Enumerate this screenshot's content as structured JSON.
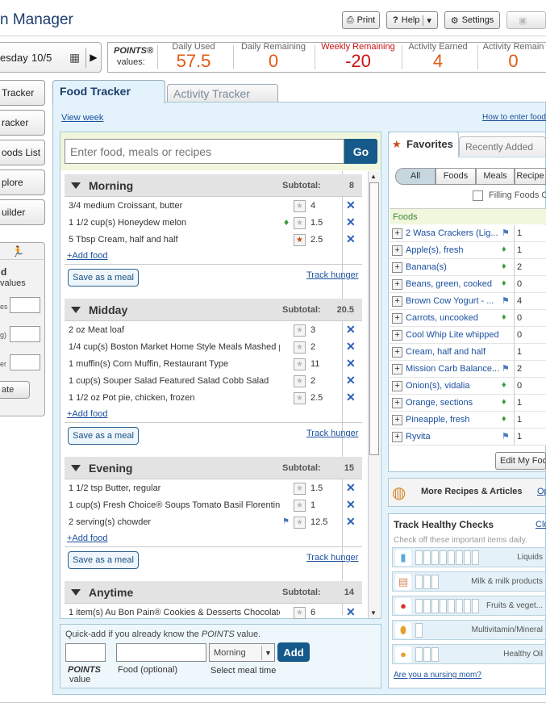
{
  "header": {
    "title": "n Manager",
    "print_label": "Print",
    "help_label": "Help",
    "settings_label": "Settings"
  },
  "datebar": {
    "date_prefix": "esday",
    "date_value": "10/5"
  },
  "points": {
    "label": "POINTS®",
    "label2": "values:",
    "cells": [
      {
        "label": "Daily Used",
        "value": "57.5",
        "color": "#e05a12"
      },
      {
        "label": "Daily Remaining",
        "value": "0",
        "color": "#e05a12"
      },
      {
        "label": "Weekly Remaining",
        "value": "-20",
        "color": "#cc1111"
      },
      {
        "label": "Activity Earned",
        "value": "4",
        "color": "#e05a12"
      },
      {
        "label": "Activity Remain",
        "value": "0",
        "color": "#e05a12"
      }
    ]
  },
  "sidebar": {
    "items": [
      "Tracker",
      "racker",
      "oods List",
      "plore",
      "uilder"
    ],
    "panel_line1": "d",
    "panel_line2": "values",
    "panel_labels": [
      "es",
      "g)",
      "er"
    ],
    "panel_button": "ate"
  },
  "tabs": {
    "food": "Food Tracker",
    "activity": "Activity Tracker"
  },
  "links": {
    "view_week": "View week",
    "how_to": "How to enter food"
  },
  "search": {
    "placeholder": "Enter food, meals or recipes",
    "go": "Go"
  },
  "meals": [
    {
      "name": "Morning",
      "subtotal_label": "Subtotal:",
      "subtotal": "8",
      "items": [
        {
          "name": "3/4 medium Croissant, butter",
          "points": "4",
          "star": false,
          "marker": ""
        },
        {
          "name": "1 1/2 cup(s) Honeydew melon",
          "points": "1.5",
          "star": false,
          "marker": "gem"
        },
        {
          "name": "5 Tbsp Cream, half and half",
          "points": "2.5",
          "star": true,
          "marker": ""
        }
      ]
    },
    {
      "name": "Midday",
      "subtotal_label": "Subtotal:",
      "subtotal": "20.5",
      "items": [
        {
          "name": "2 oz Meat loaf",
          "points": "3",
          "star": false,
          "marker": ""
        },
        {
          "name": "1/4 cup(s) Boston Market Home Style Meals Mashed p",
          "points": "2",
          "star": false,
          "marker": ""
        },
        {
          "name": "1 muffin(s) Corn Muffin, Restaurant Type",
          "points": "11",
          "star": false,
          "marker": ""
        },
        {
          "name": "1 cup(s) Souper Salad Featured Salad Cobb Salad",
          "points": "2",
          "star": false,
          "marker": ""
        },
        {
          "name": "1 1/2 oz Pot pie, chicken, frozen",
          "points": "2.5",
          "star": false,
          "marker": ""
        }
      ]
    },
    {
      "name": "Evening",
      "subtotal_label": "Subtotal:",
      "subtotal": "15",
      "items": [
        {
          "name": "1 1/2 tsp Butter, regular",
          "points": "1.5",
          "star": false,
          "marker": ""
        },
        {
          "name": "1 cup(s) Fresh Choice® Soups Tomato Basil Florentine",
          "points": "1",
          "star": false,
          "marker": ""
        },
        {
          "name": "2 serving(s) chowder",
          "points": "12.5",
          "star": false,
          "marker": "flag"
        }
      ]
    },
    {
      "name": "Anytime",
      "subtotal_label": "Subtotal:",
      "subtotal": "14",
      "items": [
        {
          "name": "1 item(s) Au Bon Pain® Cookies & Desserts Chocolate",
          "points": "6",
          "star": false,
          "marker": ""
        }
      ]
    }
  ],
  "meal_actions": {
    "add_food": "+Add food",
    "save_meal": "Save as a meal",
    "track_hunger": "Track hunger"
  },
  "quick_add": {
    "text_pre": "Quick-add if you already know the ",
    "text_em": "POINTS",
    "text_post": " value.",
    "points_label": "POINTS",
    "points_sub": "value",
    "food_label": "Food (optional)",
    "meal_value": "Morning",
    "meal_label": "Select meal time",
    "add": "Add"
  },
  "favorites": {
    "title": "Favorites",
    "recent_tab": "Recently Added",
    "filters": [
      "All",
      "Foods",
      "Meals",
      "Recipe"
    ],
    "filling_label": "Filling Foods O",
    "section": "Foods",
    "items": [
      {
        "name": "2 Wasa Crackers (Lig...",
        "mark": "flag",
        "value": "1"
      },
      {
        "name": "Apple(s), fresh",
        "mark": "gem",
        "value": "1"
      },
      {
        "name": "Banana(s)",
        "mark": "gem",
        "value": "2"
      },
      {
        "name": "Beans, green, cooked",
        "mark": "gem",
        "value": "0"
      },
      {
        "name": "Brown Cow Yogurt - ...",
        "mark": "flag",
        "value": "4"
      },
      {
        "name": "Carrots, uncooked",
        "mark": "gem",
        "value": "0"
      },
      {
        "name": "Cool Whip Lite whipped t...",
        "mark": "",
        "value": "0"
      },
      {
        "name": "Cream, half and half",
        "mark": "",
        "value": "1"
      },
      {
        "name": "Mission Carb Balance...",
        "mark": "flag",
        "value": "2"
      },
      {
        "name": "Onion(s), vidalia",
        "mark": "gem",
        "value": "0"
      },
      {
        "name": "Orange, sections",
        "mark": "gem",
        "value": "1"
      },
      {
        "name": "Pineapple, fresh",
        "mark": "gem",
        "value": "1"
      },
      {
        "name": "Ryvita",
        "mark": "flag",
        "value": "1"
      }
    ],
    "edit": "Edit My Foo"
  },
  "more_recipes": {
    "label": "More Recipes & Articles",
    "link": "Op"
  },
  "healthy": {
    "title": "Track Healthy Checks",
    "close": "Clo",
    "subtitle": "Check off these important items daily.",
    "rows": [
      {
        "label": "Liquids",
        "boxes": 8,
        "icon": "glass-icon",
        "color": "#5aa8d8"
      },
      {
        "label": "Milk & milk products",
        "boxes": 3,
        "icon": "milk-carton-icon",
        "color": "#d88a5a"
      },
      {
        "label": "Fruits & veget...",
        "boxes": 8,
        "icon": "tomato-icon",
        "color": "#d8332a"
      },
      {
        "label": "Multivitamin/Mineral",
        "boxes": 1,
        "icon": "pill-icon",
        "color": "#e6a030"
      },
      {
        "label": "Healthy Oil",
        "boxes": 3,
        "icon": "oil-drop-icon",
        "color": "#e6a030"
      }
    ],
    "nursing": "Are you a nursing mom?"
  }
}
